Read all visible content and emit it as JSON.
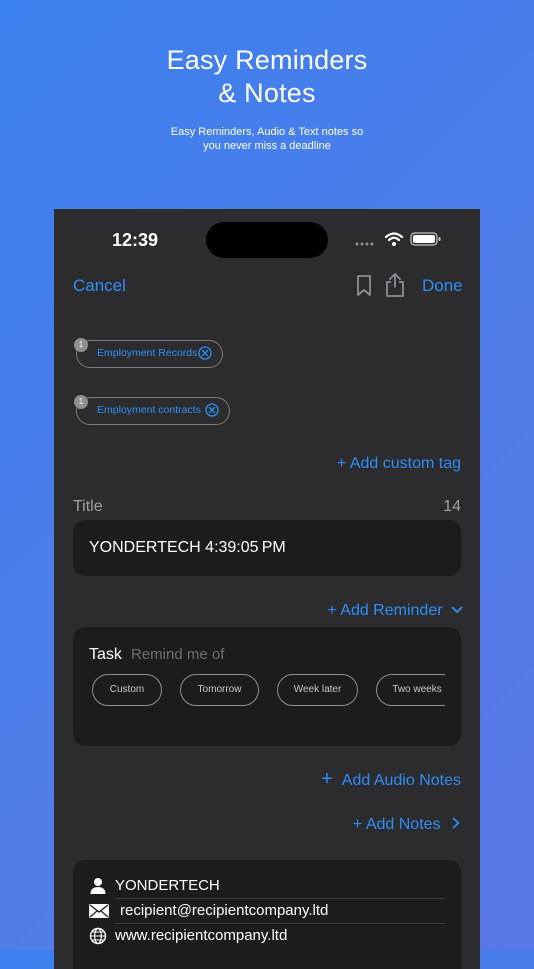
{
  "promo": {
    "headline_line1": "Easy Reminders",
    "headline_line2": "& Notes",
    "subline_line1": "Easy Reminders, Audio & Text notes so",
    "subline_line2": "you never miss a deadline"
  },
  "status_bar": {
    "time": "12:39"
  },
  "navbar": {
    "cancel": "Cancel",
    "done": "Done"
  },
  "tags": [
    {
      "count": "1",
      "label": "Employment Records"
    },
    {
      "count": "1",
      "label": "Employment contracts"
    }
  ],
  "add_custom_tag": "+ Add custom tag",
  "title_section": {
    "label": "Title",
    "count": "14",
    "value": "YONDERTECH 4:39:05 PM"
  },
  "add_reminder": "+ Add Reminder",
  "task": {
    "label": "Task",
    "placeholder": "Remind me of",
    "chips": [
      "Custom",
      "Tomorrow",
      "Week later",
      "Two weeks"
    ]
  },
  "add_audio_notes": "Add Audio Notes",
  "add_notes": "+ Add Notes",
  "contact": {
    "name": "YONDERTECH",
    "email": "recipient@recipientcompany.ltd",
    "website": "www.recipientcompany.ltd"
  },
  "colors": {
    "accent": "#2e8ef7",
    "surface": "#2c2c2e",
    "card": "#1c1c1e"
  }
}
